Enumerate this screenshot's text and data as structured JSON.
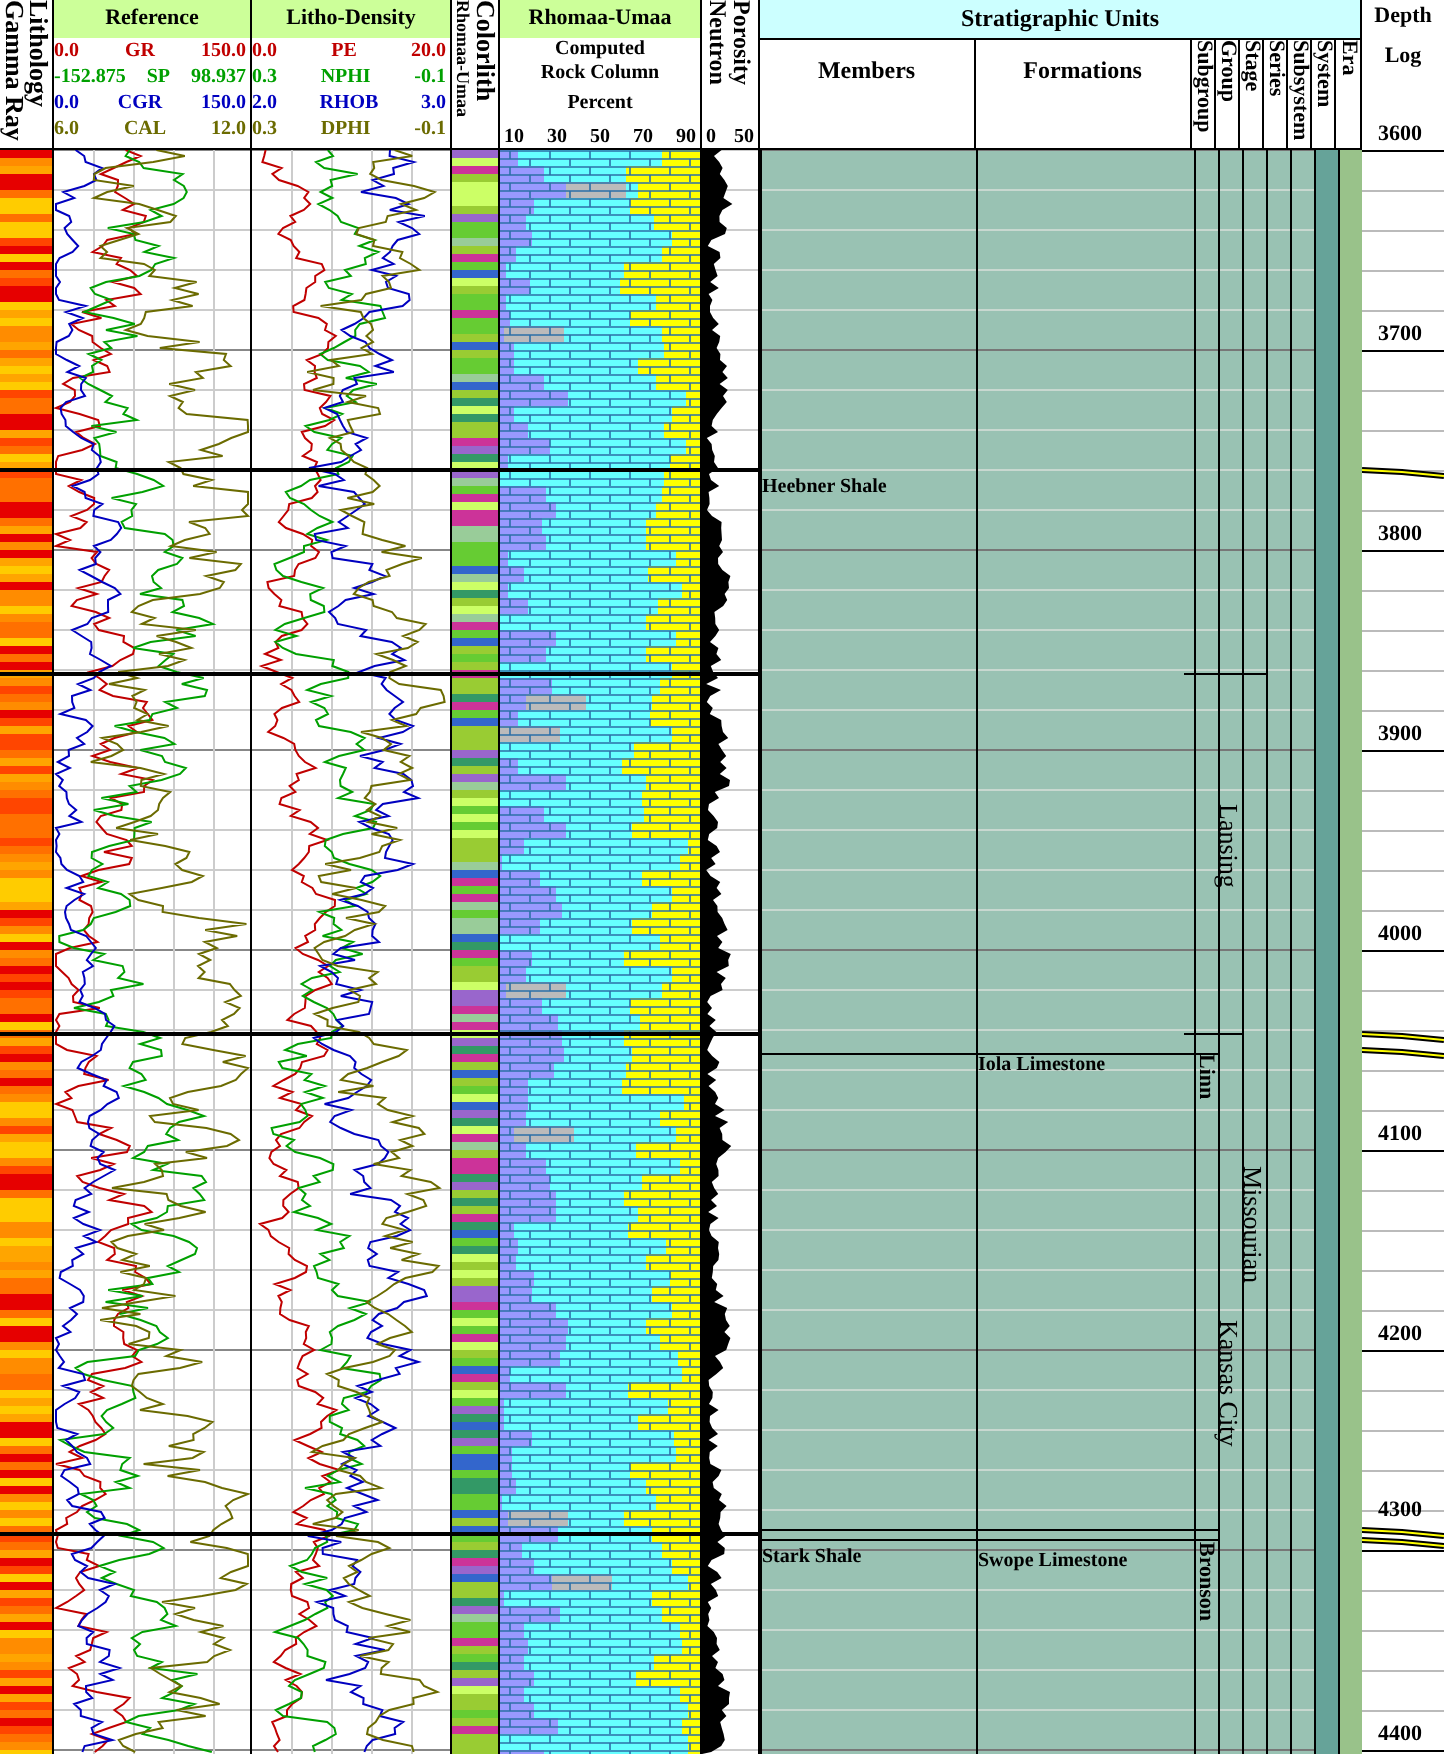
{
  "header": {
    "lithology": {
      "labels": [
        "Lithology",
        "Gamma Ray"
      ]
    },
    "reference": {
      "title": "Reference",
      "curves": [
        {
          "min": "0.0",
          "name": "GR",
          "max": "150.0",
          "color": "#c00000"
        },
        {
          "min": "-152.875",
          "name": "SP",
          "max": "98.937",
          "color": "#00a000"
        },
        {
          "min": "0.0",
          "name": "CGR",
          "max": "150.0",
          "color": "#0000c0"
        },
        {
          "min": "6.0",
          "name": "CAL",
          "max": "12.0",
          "color": "#6b6b00"
        }
      ]
    },
    "litho_density": {
      "title": "Litho-Density",
      "curves": [
        {
          "min": "0.0",
          "name": "PE",
          "max": "20.0",
          "color": "#c00000"
        },
        {
          "min": "0.3",
          "name": "NPHI",
          "max": "-0.1",
          "color": "#00a000"
        },
        {
          "min": "2.0",
          "name": "RHOB",
          "max": "3.0",
          "color": "#0000c0"
        },
        {
          "min": "0.3",
          "name": "DPHI",
          "max": "-0.1",
          "color": "#6b6b00"
        }
      ]
    },
    "colorlith": {
      "labels": [
        "Colorlith",
        "Rhomaa-Umaa"
      ]
    },
    "rhomaa_umaa": {
      "title": "Rhomaa-Umaa",
      "lines": [
        "Computed",
        "Rock Column",
        "Percent"
      ],
      "scale": [
        "10",
        "30",
        "50",
        "70",
        "90"
      ]
    },
    "porosity": {
      "labels": [
        "Porosity",
        "Neutron"
      ],
      "scale": [
        "0",
        "50"
      ]
    }
  },
  "stratigraphic_units": {
    "title": "Stratigraphic Units",
    "columns": [
      "Members",
      "Formations",
      "Subgroup",
      "Group",
      "Stage",
      "Series",
      "Subsystem",
      "System",
      "Era"
    ],
    "members": [
      "Heebner Shale",
      "Stark Shale"
    ],
    "formations": [
      "Iola Limestone",
      "Swope Limestone"
    ],
    "subgroups": [
      "Linn",
      "Bronson"
    ],
    "groups": [
      "Lansing",
      "Kansas City"
    ],
    "stages": [
      "Missourian"
    ]
  },
  "depth": {
    "title": "Depth",
    "subtitle": "Log",
    "marks": [
      "3600",
      "3700",
      "3800",
      "3900",
      "4000",
      "4100",
      "4200",
      "4300",
      "4400"
    ]
  }
}
